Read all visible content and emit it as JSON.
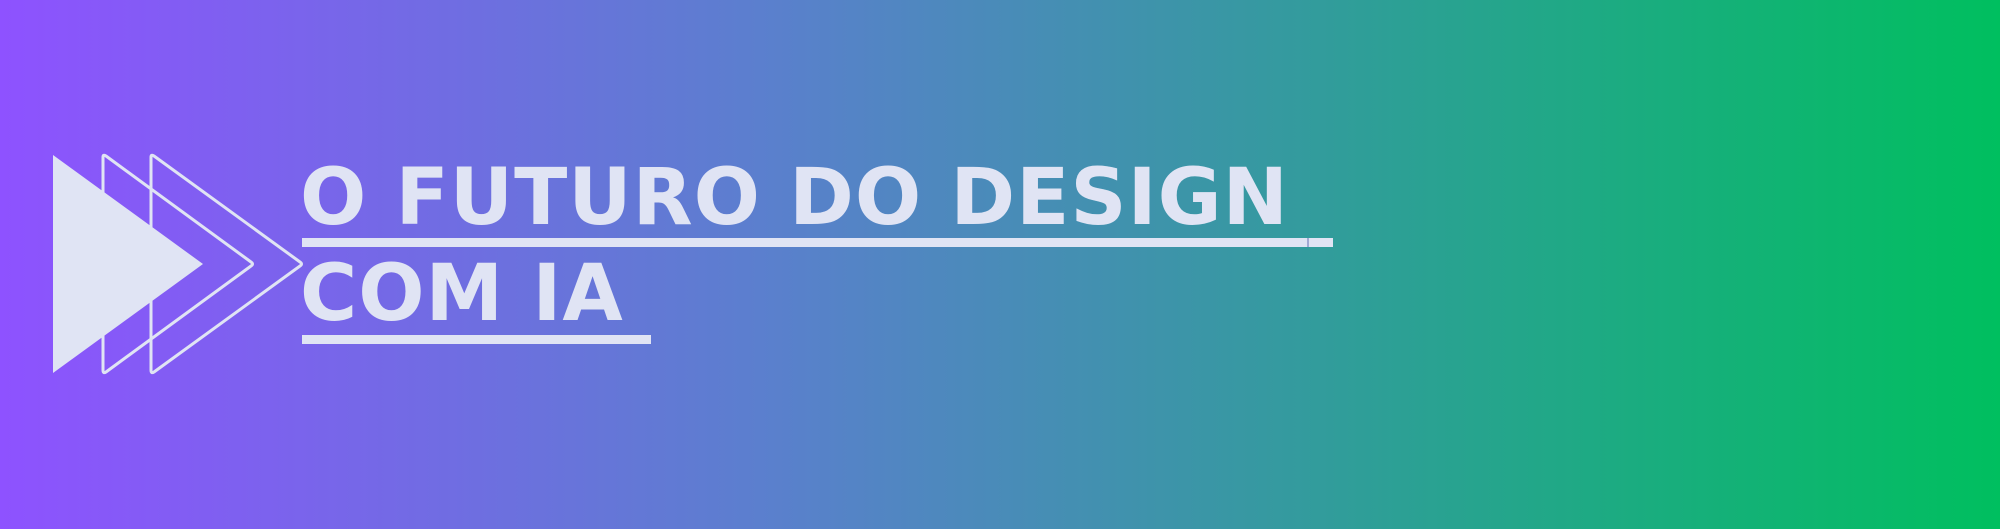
{
  "banner": {
    "gradient_start": "#8e52ff",
    "gradient_mid": "#5b7fce",
    "gradient_end": "#00bf5f",
    "text_color": "#e0e4f4",
    "logo_icon": "play-chevrons-icon",
    "title_line_1": "O FUTURO DO DESIGN",
    "title_line_2": "COM IA"
  }
}
